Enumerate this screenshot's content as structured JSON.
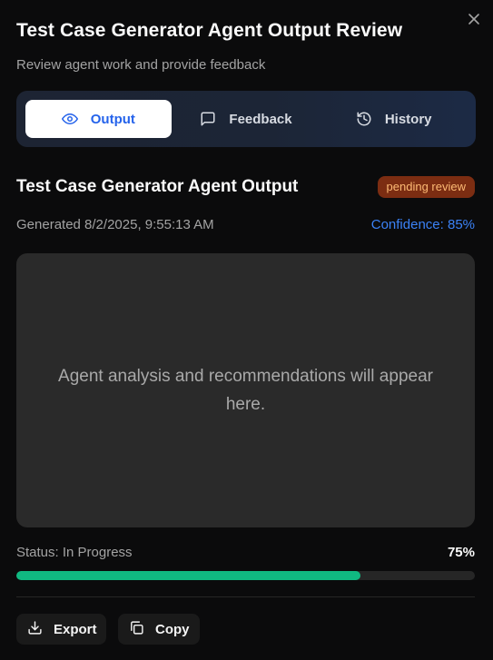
{
  "dialog": {
    "title": "Test Case Generator Agent Output Review",
    "subtitle": "Review agent work and provide feedback",
    "close_icon": "close-icon"
  },
  "tabs": [
    {
      "label": "Output",
      "icon": "eye-icon",
      "active": true
    },
    {
      "label": "Feedback",
      "icon": "message-square-icon",
      "active": false
    },
    {
      "label": "History",
      "icon": "history-icon",
      "active": false
    }
  ],
  "output": {
    "title": "Test Case Generator Agent Output",
    "badge": "pending review",
    "generated": "Generated 8/2/2025, 9:55:13 AM",
    "confidence": "Confidence: 85%",
    "placeholder": "Agent analysis and recommendations will appear here."
  },
  "status": {
    "label": "Status: In Progress",
    "percent_label": "75%",
    "progress": 0.75
  },
  "actions": {
    "export_label": "Export",
    "copy_label": "Copy"
  },
  "colors": {
    "accent": "#2563eb",
    "confidence": "#3b82f6",
    "progress": "#10b981",
    "badge_bg": "#7c2d12",
    "badge_text": "#fdba74"
  }
}
